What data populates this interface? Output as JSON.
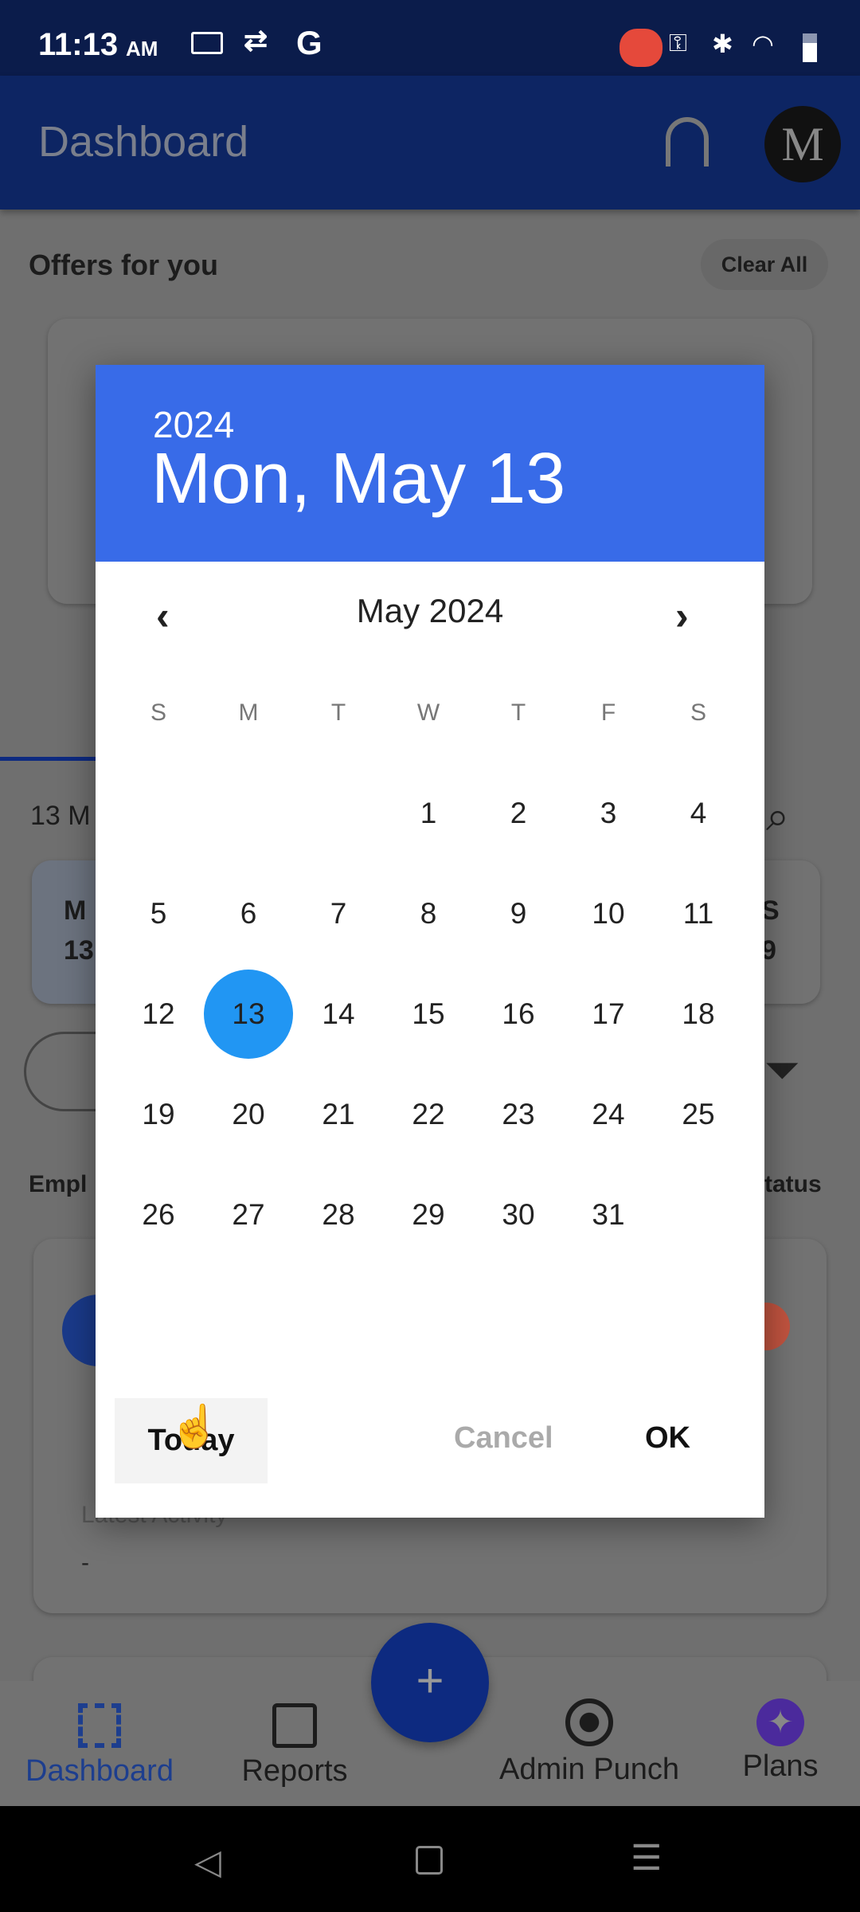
{
  "status_bar": {
    "time": "11:13",
    "ampm": "AM"
  },
  "header": {
    "title": "Dashboard"
  },
  "offers": {
    "title": "Offers for you",
    "clear_all": "Clear All"
  },
  "background": {
    "date_partial": "13 M",
    "card_left_l1": "M",
    "card_left_l2": "13",
    "card_right_l1": "S",
    "card_right_l2": "9",
    "employees_partial": "Empl",
    "status_partial": "Status",
    "latest_activity": "Latest Activity",
    "latest_value": "-"
  },
  "dialog": {
    "year": "2024",
    "selected_date": "Mon, May 13",
    "month_label": "May 2024",
    "weekdays": [
      "S",
      "M",
      "T",
      "W",
      "T",
      "F",
      "S"
    ],
    "first_weekday": 3,
    "days_in_month": 31,
    "selected_day": 13,
    "today_label": "Today",
    "cancel_label": "Cancel",
    "ok_label": "OK",
    "accent": "#386BE8",
    "selected_color": "#2196F3"
  },
  "bottom_nav": {
    "items": [
      {
        "label": "Dashboard",
        "icon": "dashboard-icon"
      },
      {
        "label": "Reports",
        "icon": "chart-icon"
      },
      {
        "label": "Admin Punch",
        "icon": "target-icon"
      },
      {
        "label": "Plans",
        "icon": "sparkle-icon"
      }
    ],
    "fab": "+"
  }
}
